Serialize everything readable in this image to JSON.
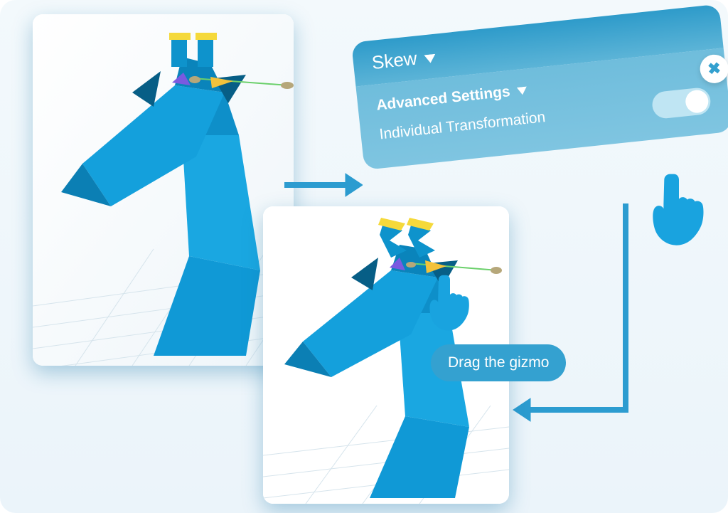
{
  "panel": {
    "title": "Skew",
    "advanced_header": "Advanced Settings",
    "option_label": "Individual Transformation",
    "toggle_on": true
  },
  "tooltip": {
    "text": "Drag the gizmo"
  },
  "colors": {
    "accent": "#19a3df",
    "panel_light": "#7cc4e0",
    "panel_dark": "#2e9bca"
  },
  "icons": {
    "close": "close-icon",
    "dropdown": "chevron-down-icon",
    "hand_pointer": "hand-pointer-icon"
  }
}
